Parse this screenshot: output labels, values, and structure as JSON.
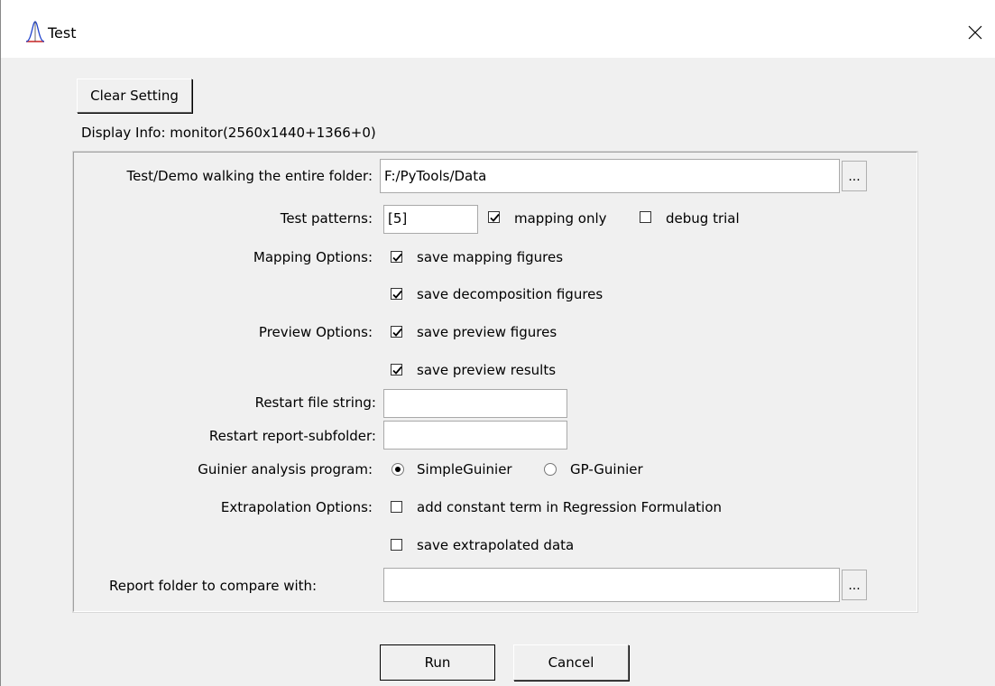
{
  "window": {
    "title": "Test"
  },
  "top_button": {
    "clear_setting": "Clear Setting"
  },
  "display_info": "Display Info: monitor(2560x1440+1366+0)",
  "form": {
    "folder_label": "Test/Demo walking the entire folder:",
    "folder_value": "F:/PyTools/Data",
    "browse_label": "...",
    "patterns_label": "Test patterns:",
    "patterns_value": "[5]",
    "mapping_only": {
      "label": "mapping only",
      "checked": true
    },
    "debug_trial": {
      "label": "debug trial",
      "checked": false
    },
    "mapping_options_label": "Mapping Options:",
    "save_mapping_figures": {
      "label": "save mapping figures",
      "checked": true
    },
    "save_decomposition_figures": {
      "label": "save decomposition figures",
      "checked": true
    },
    "preview_options_label": "Preview Options:",
    "save_preview_figures": {
      "label": "save preview figures",
      "checked": true
    },
    "save_preview_results": {
      "label": "save preview results",
      "checked": true
    },
    "restart_file_label": "Restart file string:",
    "restart_file_value": "",
    "restart_report_label": "Restart report-subfolder:",
    "restart_report_value": "",
    "guinier_label": "Guinier analysis program:",
    "guinier_options": [
      "SimpleGuinier",
      "GP-Guinier"
    ],
    "guinier_selected": "SimpleGuinier",
    "extrapolation_label": "Extrapolation Options:",
    "add_constant_term": {
      "label": "add constant term in Regression Formulation",
      "checked": false
    },
    "save_extrapolated": {
      "label": "save extrapolated data",
      "checked": false
    },
    "report_folder_label": "Report folder to compare with:",
    "report_folder_value": ""
  },
  "footer": {
    "run": "Run",
    "cancel": "Cancel"
  },
  "icons": {
    "app": "peak-curve-icon",
    "close": "close-icon"
  }
}
